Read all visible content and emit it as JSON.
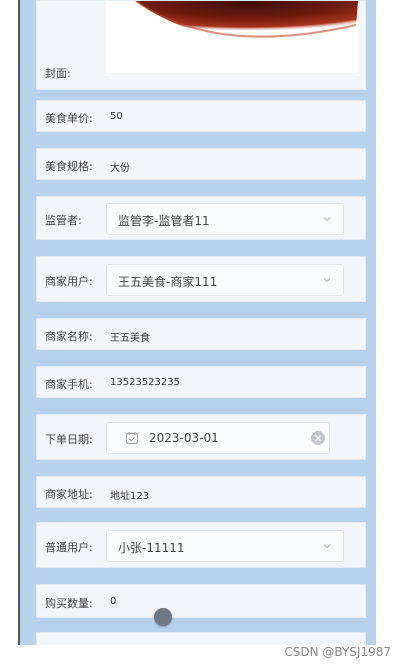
{
  "form": {
    "cover": {
      "label": "封面:"
    },
    "price": {
      "label": "美食单价:",
      "value": "50"
    },
    "spec": {
      "label": "美食规格:",
      "value": "大份"
    },
    "supervisor": {
      "label": "监管者:",
      "value": "监管李-监管者11"
    },
    "merchant_user": {
      "label": "商家用户:",
      "value": "王五美食-商家111"
    },
    "merchant_name": {
      "label": "商家名称:",
      "value": "王五美食"
    },
    "merchant_phone": {
      "label": "商家手机:",
      "value": "13523523235"
    },
    "order_date": {
      "label": "下单日期:",
      "value": "2023-03-01"
    },
    "merchant_address": {
      "label": "商家地址:",
      "value": "地址123"
    },
    "normal_user": {
      "label": "普通用户:",
      "value": "小张-11111"
    },
    "quantity": {
      "label": "购买数量:",
      "value": "0"
    }
  },
  "watermark": "CSDN @BYSJ1987",
  "colors": {
    "panel_bg": "#b7d3ec",
    "row_bg": "#f2f6fb"
  }
}
